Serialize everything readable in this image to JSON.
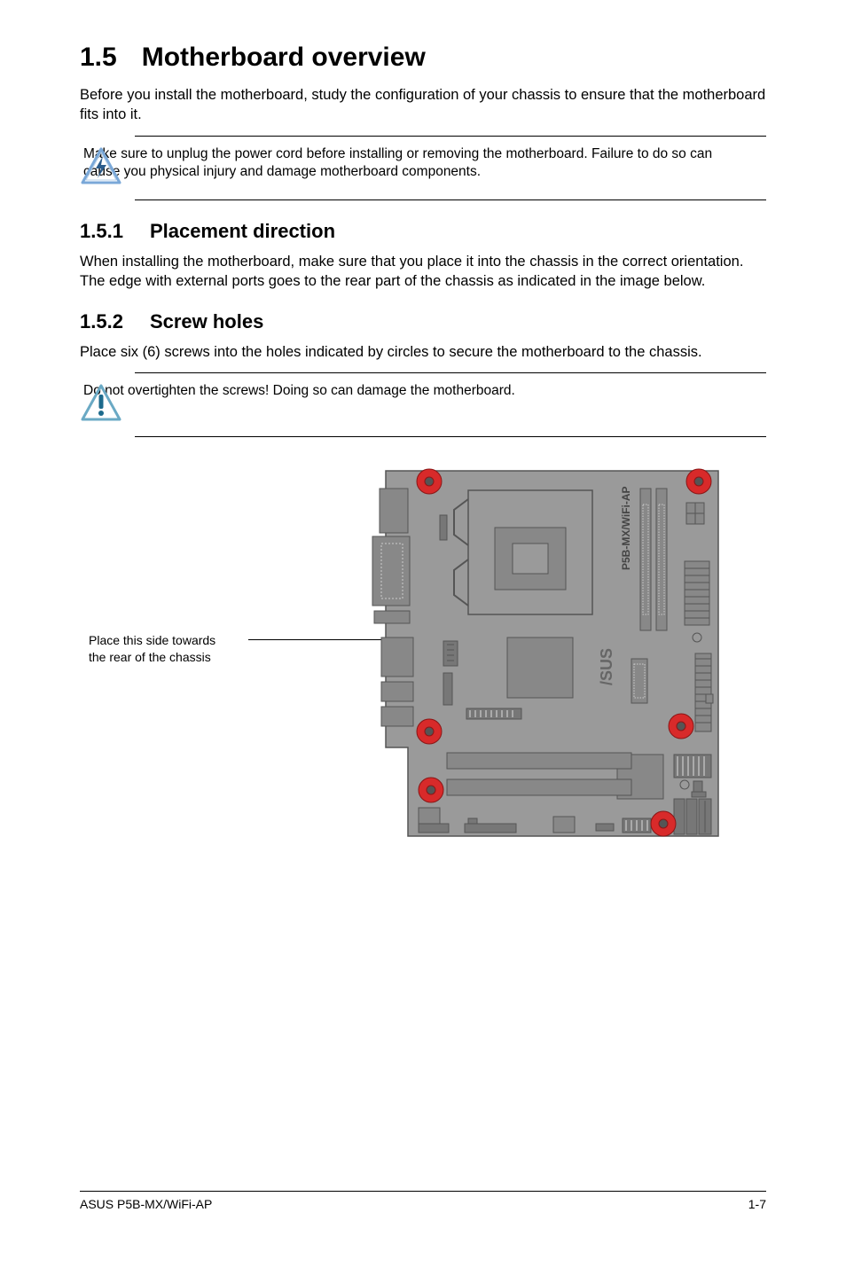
{
  "section": {
    "number": "1.5",
    "title": "Motherboard overview",
    "intro": "Before you install the motherboard, study the configuration of your chassis to ensure that the motherboard fits into it."
  },
  "warning1": {
    "text": "Make sure to unplug the power cord before installing or removing the motherboard. Failure to do so can cause you physical injury and damage motherboard components."
  },
  "sub1": {
    "number": "1.5.1",
    "title": "Placement direction",
    "text": "When installing the motherboard, make sure that you place it into the chassis in the correct orientation. The edge with external ports goes to the rear part of the chassis as indicated in the image below."
  },
  "sub2": {
    "number": "1.5.2",
    "title": "Screw holes",
    "text": "Place six (6) screws into the holes indicated by circles to secure the motherboard to the chassis."
  },
  "warning2": {
    "text": "Do not overtighten the screws! Doing so can damage the motherboard."
  },
  "diagram": {
    "side_label_line1": "Place this side towards",
    "side_label_line2": "the rear of the chassis",
    "board_model": "P5B-MX/WiFi-AP"
  },
  "footer": {
    "left": "ASUS P5B-MX/WiFi-AP",
    "right": "1-7"
  }
}
